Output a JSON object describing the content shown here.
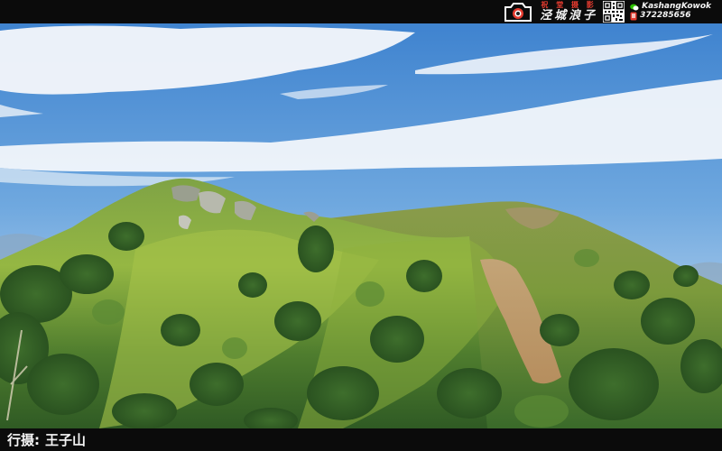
{
  "header": {
    "brand_tagline_cn": "祝 堂 摄 影",
    "brand_name_cn": "泾城浪子",
    "wechat_id": "KashangKowok",
    "phone": "372285656",
    "icons": [
      "camera-logo-icon",
      "qr-code-icon",
      "wechat-icon",
      "phone-icon"
    ]
  },
  "photo": {
    "subject": "mountain"
  },
  "footer": {
    "label": "行摄:",
    "location": "王子山"
  },
  "colors": {
    "bar_bg": "#0b0b0b",
    "accent_red": "#e53b2f",
    "text_light": "#f5f5f5"
  }
}
